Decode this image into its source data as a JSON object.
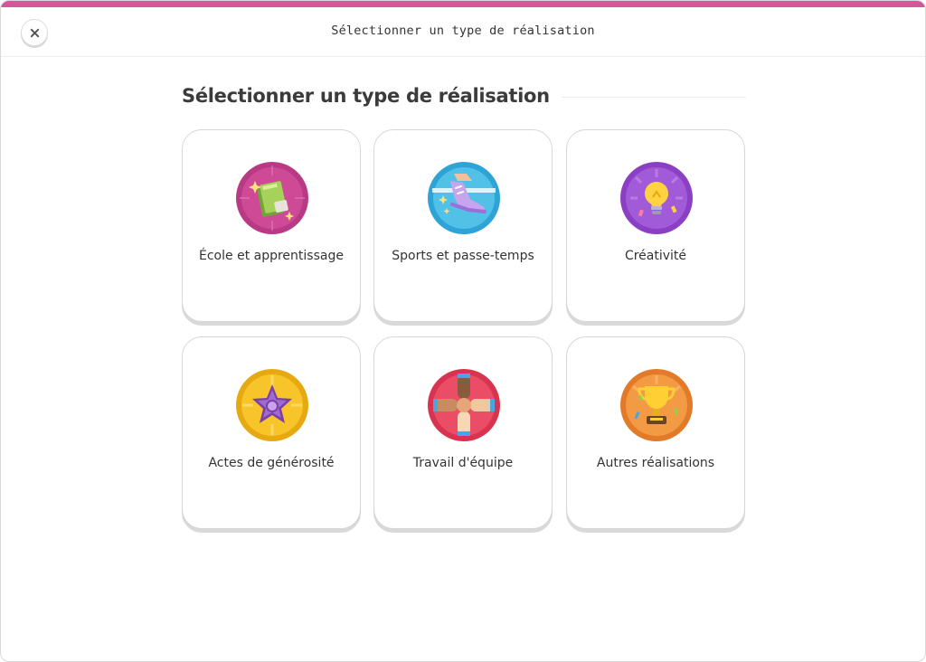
{
  "header": {
    "title": "Sélectionner un type de réalisation",
    "close_icon": "close-icon"
  },
  "section": {
    "title": "Sélectionner un type de réalisation"
  },
  "categories": [
    {
      "label": "École et apprentissage",
      "icon": "books-icon",
      "color": "#c8418f"
    },
    {
      "label": "Sports et passe-temps",
      "icon": "sneaker-icon",
      "color": "#46b8e3"
    },
    {
      "label": "Créativité",
      "icon": "lightbulb-icon",
      "color": "#9b4fd1"
    },
    {
      "label": "Actes de générosité",
      "icon": "star-badge-icon",
      "color": "#f2bd1a"
    },
    {
      "label": "Travail d'équipe",
      "icon": "hands-together-icon",
      "color": "#e8415f"
    },
    {
      "label": "Autres réalisations",
      "icon": "trophy-icon",
      "color": "#ef8a35"
    }
  ],
  "colors": {
    "accent": "#d3579a"
  }
}
